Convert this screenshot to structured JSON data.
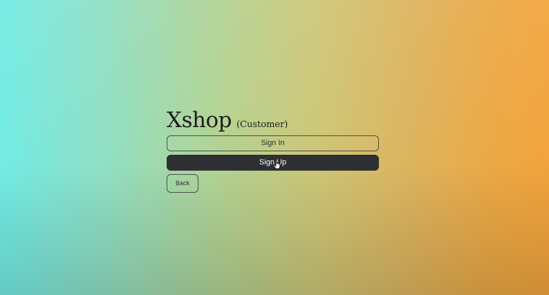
{
  "brand": {
    "name": "Xshop",
    "role": "(Customer)"
  },
  "actions": {
    "sign_in_label": "Sign In",
    "sign_up_label": "Sign Up",
    "back_label": "Back"
  },
  "icons": {
    "pointer": "hand-pointer-cursor-icon"
  },
  "colors": {
    "background_left": "#72ece5",
    "background_right": "#f2a43d",
    "primary_button": "#2e3034",
    "text": "#1d1d1d"
  }
}
